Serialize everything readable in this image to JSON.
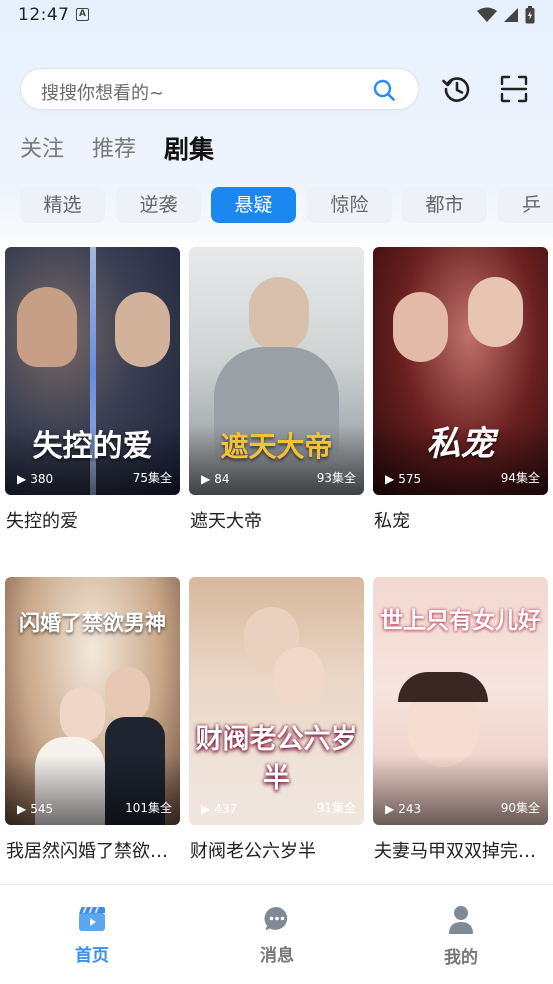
{
  "status_bar": {
    "time": "12:47",
    "notif_letter": "A"
  },
  "search": {
    "placeholder": "搜搜你想看的~"
  },
  "top_tabs": [
    {
      "label": "关注",
      "active": false
    },
    {
      "label": "推荐",
      "active": false
    },
    {
      "label": "剧集",
      "active": true
    }
  ],
  "categories": [
    {
      "label": "精选",
      "active": false
    },
    {
      "label": "逆袭",
      "active": false
    },
    {
      "label": "悬疑",
      "active": true
    },
    {
      "label": "惊险",
      "active": false
    },
    {
      "label": "都市",
      "active": false
    },
    {
      "label": "乒",
      "active": false
    }
  ],
  "dramas": [
    {
      "name": "失控的爱",
      "poster_text": "失控的爱",
      "plays": "380",
      "episodes": "75集全"
    },
    {
      "name": "遮天大帝",
      "poster_text": "遮天大帝",
      "plays": "84",
      "episodes": "93集全"
    },
    {
      "name": "私宠",
      "poster_text": "私宠",
      "plays": "575",
      "episodes": "94集全"
    },
    {
      "name": "我居然闪婚了禁欲…",
      "poster_text": "闪婚了禁欲男神",
      "plays": "545",
      "episodes": "101集全"
    },
    {
      "name": "财阀老公六岁半",
      "poster_text": "财阀老公六岁半",
      "plays": "437",
      "episodes": "91集全"
    },
    {
      "name": "夫妻马甲双双掉完…",
      "poster_text": "世上只有女儿好",
      "plays": "243",
      "episodes": "90集全"
    }
  ],
  "bottom_nav": [
    {
      "label": "首页",
      "icon": "clapperboard-icon",
      "active": true
    },
    {
      "label": "消息",
      "icon": "chat-bubble-icon",
      "active": false
    },
    {
      "label": "我的",
      "icon": "person-icon",
      "active": false
    }
  ],
  "colors": {
    "accent": "#1a88f0",
    "nav_active": "#3a8fe6"
  }
}
